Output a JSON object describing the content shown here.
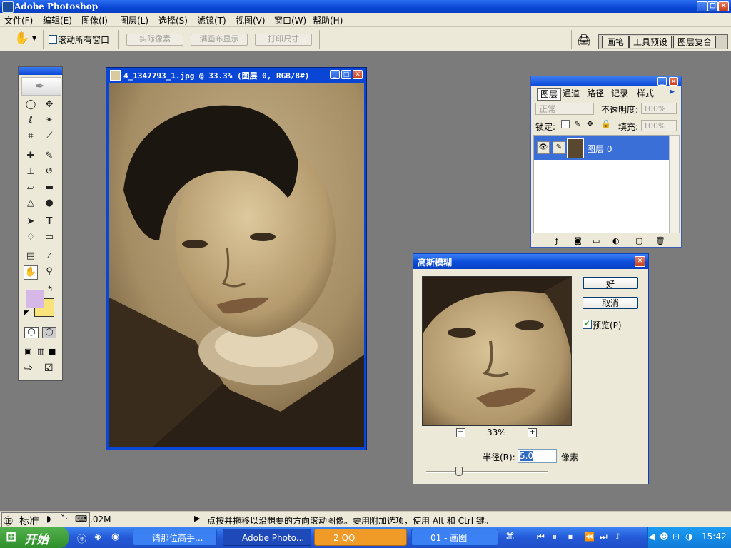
{
  "app": {
    "title": "Adobe Photoshop"
  },
  "menu": [
    "文件(F)",
    "编辑(E)",
    "图像(I)",
    "图层(L)",
    "选择(S)",
    "滤镜(T)",
    "视图(V)",
    "窗口(W)",
    "帮助(H)"
  ],
  "options": {
    "scroll_all_label": "滚动所有窗口",
    "actual_pixels": "实际像素",
    "fit_screen": "满画布显示",
    "print_size": "打印尺寸",
    "palette_tabs": [
      "画笔",
      "工具预设",
      "图层复合"
    ]
  },
  "colors": {
    "foreground": "#d5b8e8",
    "background": "#f8e27a",
    "accent": "#0a46d5"
  },
  "document": {
    "title": "4_1347793_1.jpg @ 33.3% (图层 0, RGB/8#)"
  },
  "layers_panel": {
    "tabs": [
      "图层",
      "通道",
      "路径",
      "记录",
      "样式"
    ],
    "blend_mode": "正常",
    "opacity_label": "不透明度:",
    "opacity_value": "100%",
    "lock_label": "锁定:",
    "fill_label": "填充:",
    "fill_value": "100%",
    "layer_name": "图层 0"
  },
  "gaussian_dialog": {
    "title": "高斯模糊",
    "ok": "好",
    "cancel": "取消",
    "preview_label": "预览(P)",
    "preview_checked": true,
    "zoom": "33%",
    "radius_label": "半径(R):",
    "radius_value": "5.0",
    "unit": "像素"
  },
  "status": {
    "ime_label": "标准",
    "doc_size": ".02M",
    "hint": "点按并拖移以沿想要的方向滚动图像。要用附加选项，使用 Alt 和 Ctrl 键。"
  },
  "taskbar": {
    "start": "开始",
    "tasks": [
      "请那位高手...",
      "Adobe Photo...",
      "2 QQ",
      "01 - 画图"
    ],
    "clock": "15:42"
  }
}
